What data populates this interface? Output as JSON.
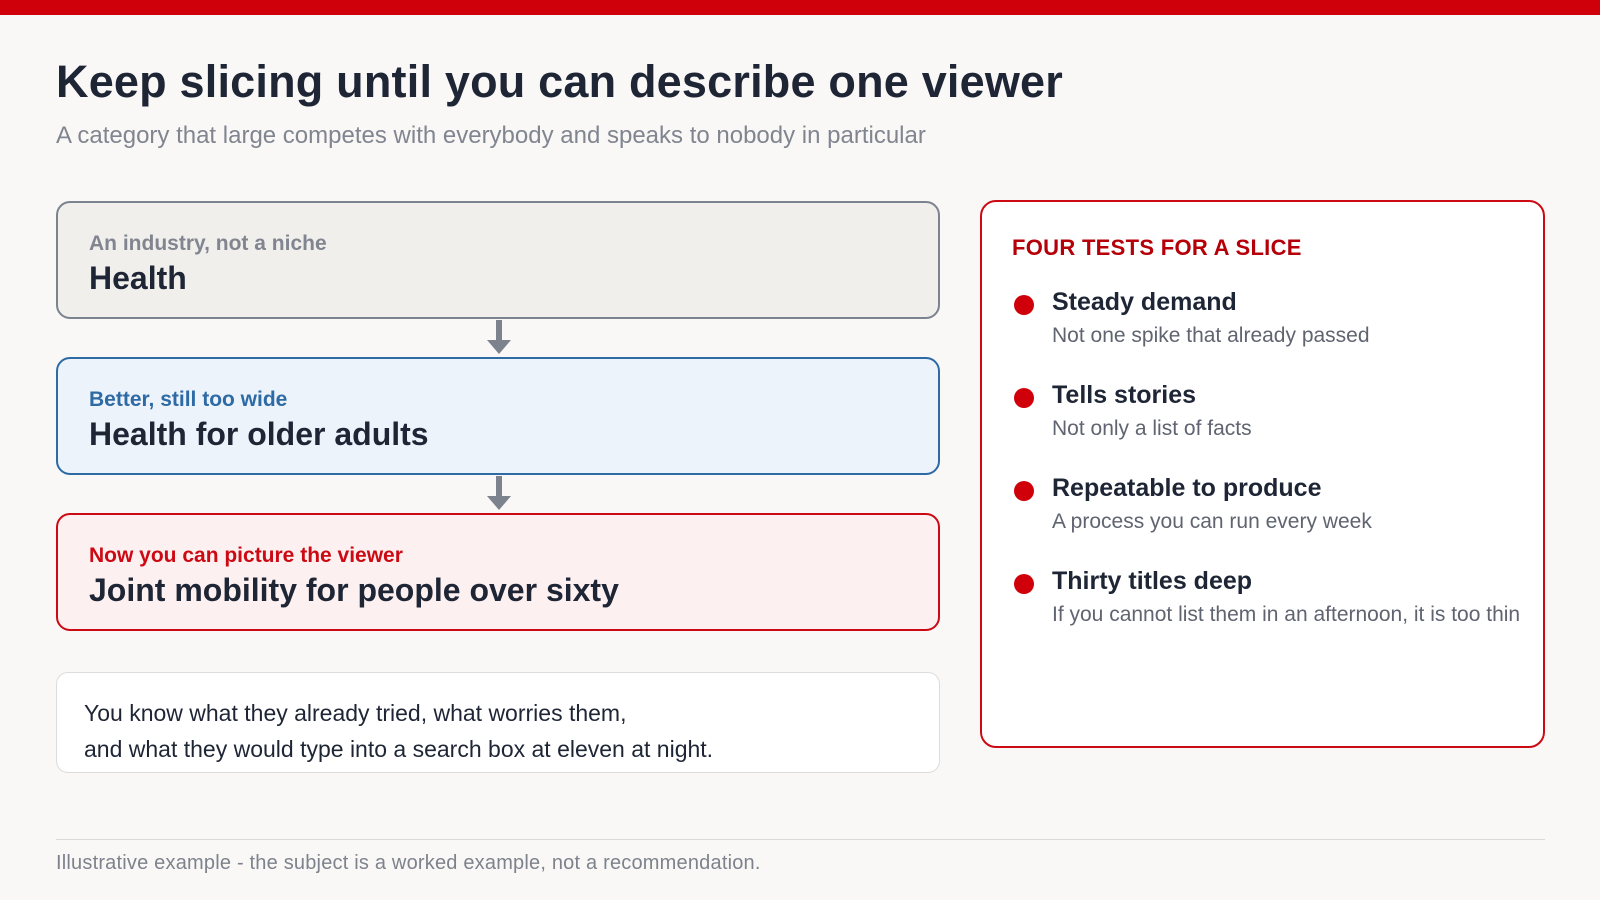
{
  "header": {
    "title": "Keep slicing until you can describe one viewer",
    "subtitle": "A category that large competes with everybody and speaks to nobody in particular"
  },
  "funnel": [
    {
      "kicker": "An industry, not a niche",
      "label": "Health"
    },
    {
      "kicker": "Better, still too wide",
      "label": "Health for older adults"
    },
    {
      "kicker": "Now you can picture the viewer",
      "label": "Joint mobility for people over sixty"
    }
  ],
  "note": {
    "line1": "You know what they already tried, what worries them,",
    "line2": "and what they would type into a search box at eleven at night."
  },
  "tests_panel": {
    "title": "FOUR TESTS FOR A SLICE",
    "items": [
      {
        "title": "Steady demand",
        "desc": "Not one spike that already passed"
      },
      {
        "title": "Tells stories",
        "desc": "Not only a list of facts"
      },
      {
        "title": "Repeatable to produce",
        "desc": "A process you can run every week"
      },
      {
        "title": "Thirty titles deep",
        "desc": "If you cannot list them in an afternoon, it is too thin"
      }
    ]
  },
  "footer": "Illustrative example - the subject is a worked example, not a recommendation.",
  "colors": {
    "accent_red": "#d0000b",
    "blue": "#2e6aa4",
    "gray": "#7c838e",
    "background": "#f9f8f6"
  }
}
